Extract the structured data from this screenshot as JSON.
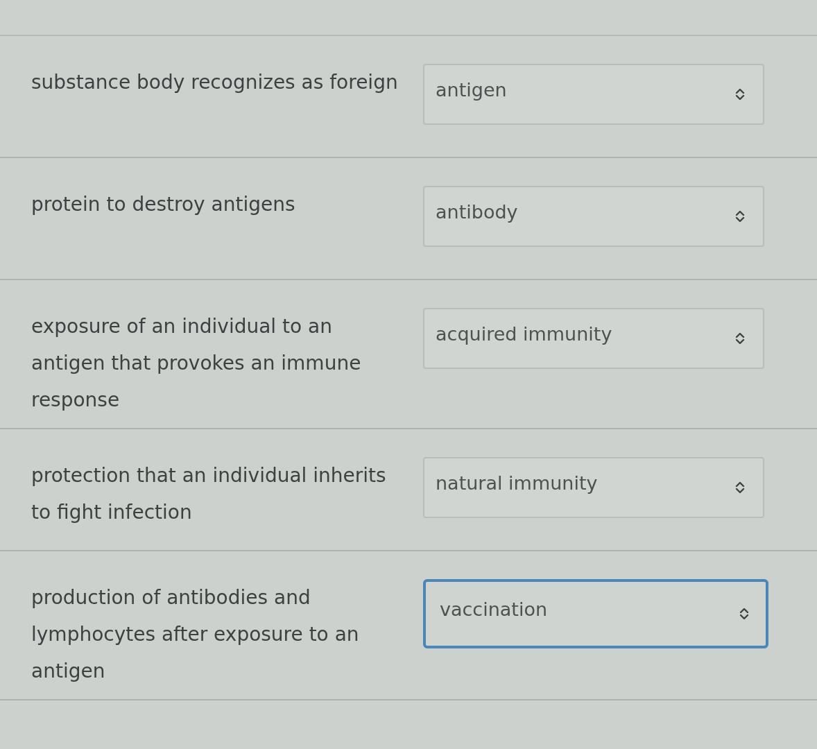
{
  "questions": [
    {
      "prompt": "substance body recognizes as foreign",
      "answer": "antigen",
      "focused": false
    },
    {
      "prompt": "protein to destroy antigens",
      "answer": "antibody",
      "focused": false
    },
    {
      "prompt": "exposure of an individual to an antigen that provokes an immune response",
      "answer": "acquired immunity",
      "focused": false
    },
    {
      "prompt": "protection that an individual inherits to fight infection",
      "answer": "natural immunity",
      "focused": false
    },
    {
      "prompt": "production of antibodies and lymphocytes after exposure to an antigen",
      "answer": "vaccination",
      "focused": true
    }
  ]
}
